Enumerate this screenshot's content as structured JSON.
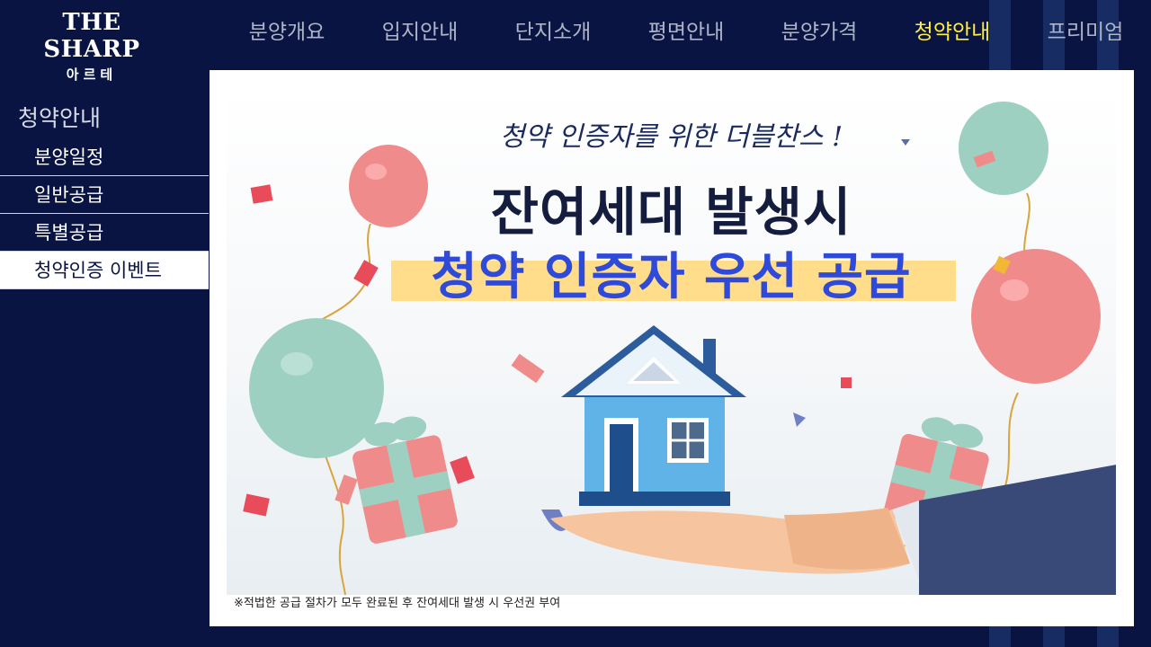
{
  "logo": {
    "brand": "THE SHARP",
    "sub": "아르테"
  },
  "topnav": [
    {
      "label": "분양개요",
      "active": false
    },
    {
      "label": "입지안내",
      "active": false
    },
    {
      "label": "단지소개",
      "active": false
    },
    {
      "label": "평면안내",
      "active": false
    },
    {
      "label": "분양가격",
      "active": false
    },
    {
      "label": "청약안내",
      "active": true
    },
    {
      "label": "프리미엄",
      "active": false
    }
  ],
  "sidebar": {
    "title": "청약안내",
    "items": [
      {
        "label": "분양일정",
        "active": false
      },
      {
        "label": "일반공급",
        "active": false
      },
      {
        "label": "특별공급",
        "active": false
      },
      {
        "label": "청약인증 이벤트",
        "active": true
      }
    ]
  },
  "banner": {
    "script_line": "청약 인증자를 위한 더블찬스 !",
    "headline": "잔여세대 발생시",
    "accent_line": "청약 인증자 우선 공급"
  },
  "footnote": "※적법한 공급 절차가 모두 완료된 후 잔여세대 발생 시 우선권 부여",
  "colors": {
    "background": "#0a1442",
    "active_nav": "#ffee44",
    "accent": "#2f49d8",
    "highlight": "#ffdd8a"
  }
}
